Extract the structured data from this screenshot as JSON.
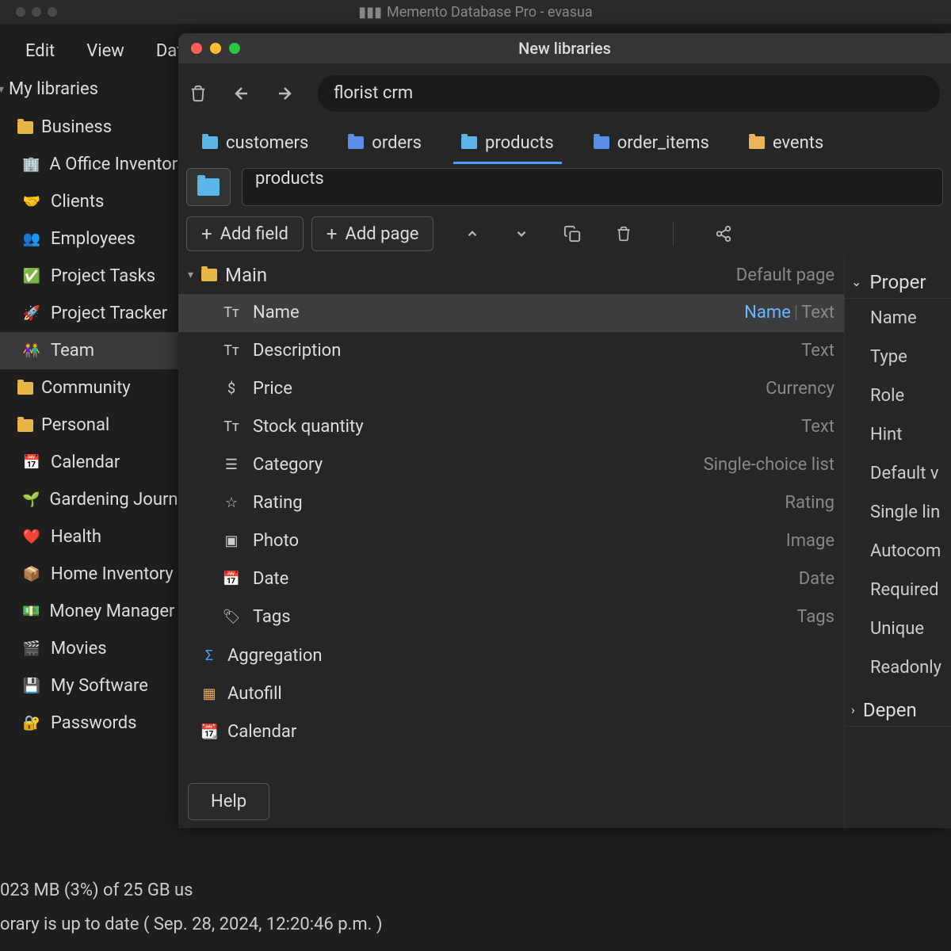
{
  "main_window": {
    "title": "Memento Database Pro - evasua"
  },
  "menubar": {
    "items": [
      "Edit",
      "View",
      "Dat"
    ]
  },
  "sidebar": {
    "header": "My libraries",
    "groups": [
      {
        "name": "Business",
        "items": [
          {
            "label": "A Office Inventory",
            "emoji": "🏢"
          },
          {
            "label": "Clients",
            "emoji": "🤝"
          },
          {
            "label": "Employees",
            "emoji": "👥"
          },
          {
            "label": "Project Tasks",
            "emoji": "✅"
          },
          {
            "label": "Project Tracker",
            "emoji": "🚀"
          },
          {
            "label": "Team",
            "emoji": "👫",
            "selected": true
          }
        ]
      },
      {
        "name": "Community",
        "items": []
      },
      {
        "name": "Personal",
        "items": [
          {
            "label": "Calendar",
            "emoji": "📅"
          },
          {
            "label": "Gardening Journa",
            "emoji": "🌱"
          },
          {
            "label": "Health",
            "emoji": "❤️"
          },
          {
            "label": "Home Inventory",
            "emoji": "📦"
          },
          {
            "label": "Money Manager",
            "emoji": "💵"
          },
          {
            "label": "Movies",
            "emoji": "🎬"
          },
          {
            "label": "My Software",
            "emoji": "💾"
          },
          {
            "label": "Passwords",
            "emoji": "🔐"
          }
        ]
      }
    ]
  },
  "statusbar": {
    "line1": "023 MB (3%) of 25 GB us",
    "line2": "orary is up to date ( Sep. 28, 2024, 12:20:46 p.m. )"
  },
  "modal": {
    "title": "New libraries",
    "search_value": "florist crm",
    "tabs": [
      {
        "label": "customers"
      },
      {
        "label": "orders"
      },
      {
        "label": "products",
        "active": true
      },
      {
        "label": "order_items"
      },
      {
        "label": "events"
      }
    ],
    "library_name": "products",
    "actions": {
      "add_field": "Add field",
      "add_page": "Add page"
    },
    "group": {
      "name": "Main",
      "meta": "Default page"
    },
    "fields": [
      {
        "name": "Name",
        "type": "Text",
        "role": "Name",
        "icon": "Tт",
        "selected": true
      },
      {
        "name": "Description",
        "type": "Text",
        "icon": "Tт"
      },
      {
        "name": "Price",
        "type": "Currency",
        "icon": "$"
      },
      {
        "name": "Stock quantity",
        "type": "Text",
        "icon": "Tт"
      },
      {
        "name": "Category",
        "type": "Single-choice list",
        "icon": "☰"
      },
      {
        "name": "Rating",
        "type": "Rating",
        "icon": "☆"
      },
      {
        "name": "Photo",
        "type": "Image",
        "icon": "▣"
      },
      {
        "name": "Date",
        "type": "Date",
        "icon": "📅"
      },
      {
        "name": "Tags",
        "type": "Tags",
        "icon": "🏷"
      }
    ],
    "sections": [
      {
        "name": "Aggregation",
        "icon": "Σ",
        "color": "#4a9eff"
      },
      {
        "name": "Autofill",
        "icon": "▦",
        "color": "#e8a95b"
      },
      {
        "name": "Calendar",
        "icon": "📆",
        "color": ""
      }
    ],
    "properties": {
      "header": "Proper",
      "rows": [
        "Name",
        "Type",
        "Role",
        "Hint",
        "Default v",
        "Single lin",
        "Autocom",
        "Required",
        "Unique",
        "Readonly"
      ],
      "depend_header": "Depen"
    },
    "help": "Help"
  }
}
